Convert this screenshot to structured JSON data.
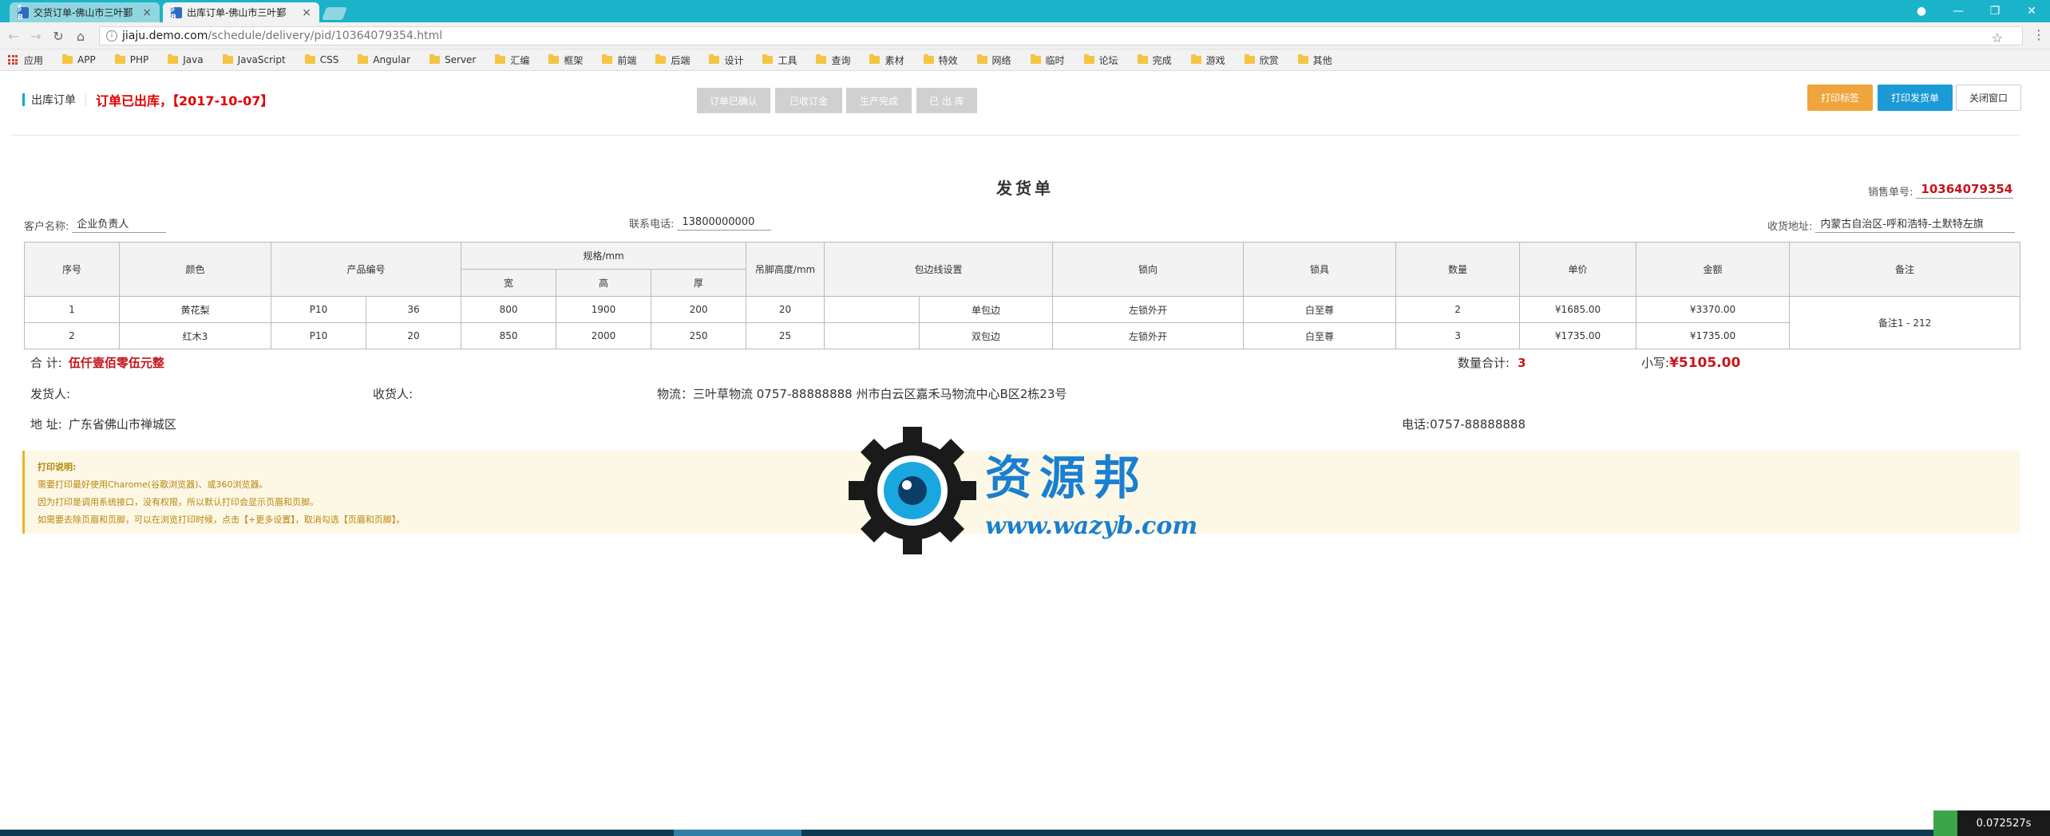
{
  "browser": {
    "tabs": [
      {
        "favicon": "阝B",
        "label": "交货订单-佛山市三叶鄞"
      },
      {
        "favicon": "阝B",
        "label": "出库订单-佛山市三叶鄞"
      }
    ],
    "url_host": "jiaju.demo.com",
    "url_path": "/schedule/delivery/pid/10364079354.html",
    "bookmarks": [
      "应用",
      "APP",
      "PHP",
      "Java",
      "JavaScript",
      "CSS",
      "Angular",
      "Server",
      "汇编",
      "框架",
      "前端",
      "后端",
      "设计",
      "工具",
      "查询",
      "素材",
      "特效",
      "网络",
      "临时",
      "论坛",
      "完成",
      "游戏",
      "欣赏",
      "其他"
    ]
  },
  "header": {
    "section": "出库订单",
    "status": "订单已出库，【2017-10-07】",
    "steps": [
      "订单已确认",
      "已收订金",
      "生产完成",
      "已 出 库"
    ],
    "buttons": {
      "print_label": "打印标签",
      "print_delivery": "打印发货单",
      "close": "关闭窗口"
    }
  },
  "doc": {
    "title": "发货单",
    "order_no_label": "销售单号:",
    "order_no": "10364079354",
    "customer_label": "客户名称:",
    "customer": "企业负责人",
    "phone_label": "联系电话:",
    "phone": "13800000000",
    "address_label": "收货地址:",
    "address": "内蒙古自治区-呼和浩特-土默特左旗"
  },
  "table": {
    "headers": {
      "seq": "序号",
      "color": "颜色",
      "product_no": "产品编号",
      "spec": "规格/mm",
      "width": "宽",
      "height": "高",
      "thick": "厚",
      "foot": "吊脚高度/mm",
      "edge": "包边线设置",
      "lock_dir": "锁向",
      "lock": "锁具",
      "qty": "数量",
      "price": "单价",
      "amount": "金额",
      "remark": "备注"
    },
    "rows": [
      {
        "seq": "1",
        "color": "黄花梨",
        "product_no": "P10",
        "product_sub": "36",
        "width": "800",
        "height": "1900",
        "thick": "200",
        "foot": "20",
        "edge_a": "",
        "edge_b": "单包边",
        "lock_dir": "左锁外开",
        "lock": "白至尊",
        "qty": "2",
        "price": "¥1685.00",
        "amount": "¥3370.00"
      },
      {
        "seq": "2",
        "color": "红木3",
        "product_no": "P10",
        "product_sub": "20",
        "width": "850",
        "height": "2000",
        "thick": "250",
        "foot": "25",
        "edge_a": "",
        "edge_b": "双包边",
        "lock_dir": "左锁外开",
        "lock": "白至尊",
        "qty": "3",
        "price": "¥1735.00",
        "amount": "¥1735.00"
      }
    ],
    "remark": "备注1 - 212"
  },
  "summary": {
    "total_label": "合  计:",
    "total_words": "伍仟壹佰零伍元整",
    "qty_label": "数量合计:",
    "qty_total": "3",
    "small_label": "小写:",
    "small_total": "¥5105.00"
  },
  "shipping": {
    "shipper_label": "发货人:",
    "receiver_label": "收货人:",
    "logistics": "物流：三叶草物流   0757-88888888   州市白云区嘉禾马物流中心B区2栋23号",
    "addr_label": "地  址:",
    "addr": "广东省佛山市禅城区",
    "tel_label": "电话:",
    "tel": "0757-88888888"
  },
  "notice": {
    "title": "打印说明:",
    "lines": [
      "需要打印最好使用Charome(谷歌浏览器)、或360浏览器。",
      "因为打印是调用系统接口，没有权限，所以默认打印会显示页眉和页脚。",
      "如需要去除页眉和页脚，可以在浏览打印时候，点击【+更多设置】，取消勾选【页眉和页脚】。"
    ]
  },
  "watermark": {
    "cn": "资源邦",
    "url": "www.wazyb.com"
  },
  "timer": "0.072527s",
  "colors": {
    "accent": "#1bb3c9",
    "red": "#c4161c",
    "orange": "#f0a43c",
    "blue": "#1a9ad6"
  }
}
